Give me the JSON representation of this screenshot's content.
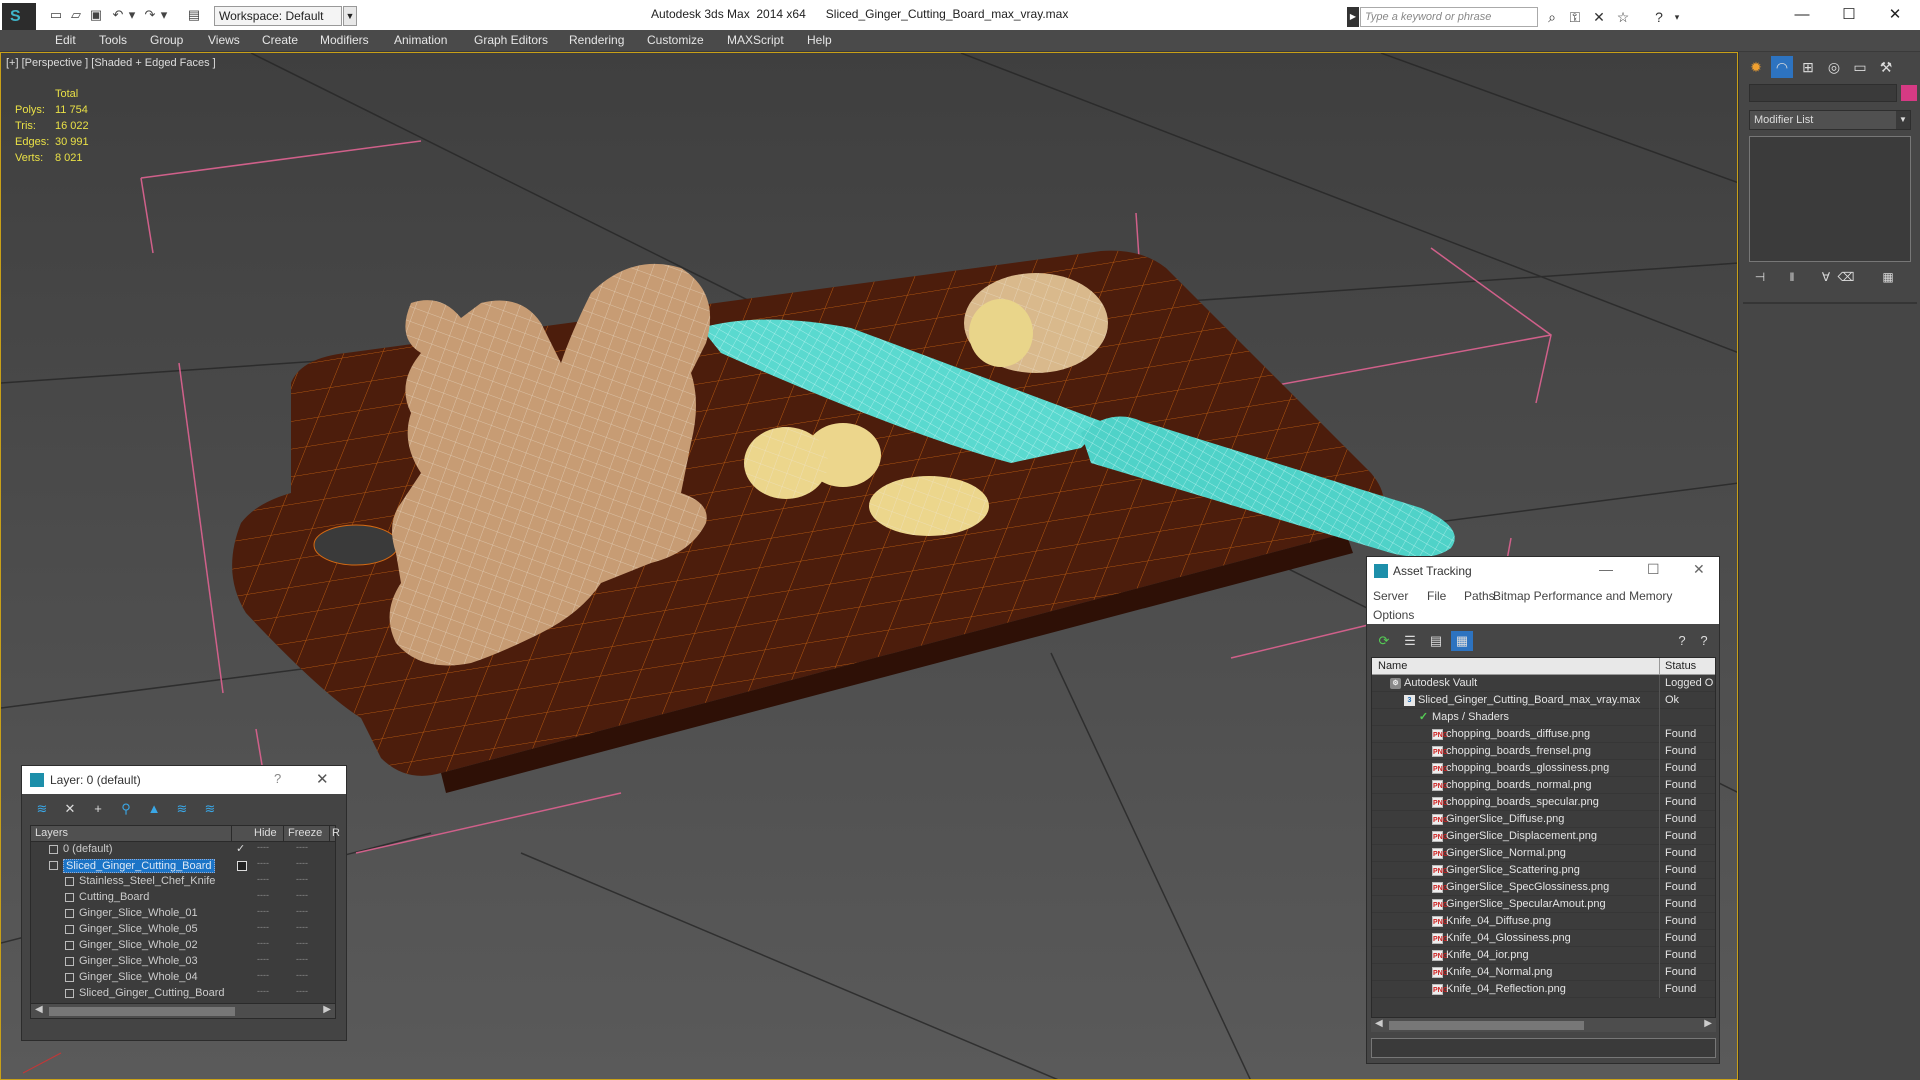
{
  "titlebar": {
    "app_title": "Autodesk 3ds Max  2014 x64      Sliced_Ginger_Cutting_Board_max_vray.max",
    "workspace_label": "Workspace: Default",
    "search_placeholder": "Type a keyword or phrase",
    "logo_glyph": "S",
    "icons": [
      "new-icon",
      "open-icon",
      "save-icon",
      "undo-icon",
      "redo-icon",
      "project-icon"
    ]
  },
  "menubar": {
    "items": [
      "Edit",
      "Tools",
      "Group",
      "Views",
      "Create",
      "Modifiers",
      "Animation",
      "Graph Editors",
      "Rendering",
      "Customize",
      "MAXScript",
      "Help"
    ]
  },
  "viewport": {
    "label": "[+] [Perspective ] [Shaded + Edged Faces ]",
    "stats": {
      "total_label": "Total",
      "rows": [
        {
          "label": "Polys:",
          "value": "11 754"
        },
        {
          "label": "Tris:",
          "value": "16 022"
        },
        {
          "label": "Edges:",
          "value": "30 991"
        },
        {
          "label": "Verts:",
          "value": "8 021"
        }
      ]
    }
  },
  "command_panel": {
    "modifier_list": "Modifier List",
    "color_swatch": "#d63a84"
  },
  "layer_dialog": {
    "title": "Layer: 0 (default)",
    "help": "?",
    "columns": {
      "layers": "Layers",
      "hide": "Hide",
      "freeze": "Freeze",
      "render": "R"
    },
    "rows": [
      {
        "name": "0 (default)",
        "indent": 0,
        "checked": true,
        "selected": false
      },
      {
        "name": "Sliced_Ginger_Cutting_Board",
        "indent": 0,
        "checked": false,
        "selected": true
      },
      {
        "name": "Stainless_Steel_Chef_Knife",
        "indent": 1,
        "checked": false,
        "selected": false
      },
      {
        "name": "Cutting_Board",
        "indent": 1,
        "checked": false,
        "selected": false
      },
      {
        "name": "Ginger_Slice_Whole_01",
        "indent": 1,
        "checked": false,
        "selected": false
      },
      {
        "name": "Ginger_Slice_Whole_05",
        "indent": 1,
        "checked": false,
        "selected": false
      },
      {
        "name": "Ginger_Slice_Whole_02",
        "indent": 1,
        "checked": false,
        "selected": false
      },
      {
        "name": "Ginger_Slice_Whole_03",
        "indent": 1,
        "checked": false,
        "selected": false
      },
      {
        "name": "Ginger_Slice_Whole_04",
        "indent": 1,
        "checked": false,
        "selected": false
      },
      {
        "name": "Sliced_Ginger_Cutting_Board",
        "indent": 1,
        "checked": false,
        "selected": false
      }
    ],
    "cell_dash": "----"
  },
  "asset_dialog": {
    "title": "Asset Tracking",
    "menus": {
      "server": "Server",
      "file": "File",
      "paths": "Paths",
      "bitmap": "Bitmap Performance and Memory",
      "options": "Options"
    },
    "columns": {
      "name": "Name",
      "status": "Status"
    },
    "rows": [
      {
        "name": "Autodesk Vault",
        "status": "Logged O",
        "indent": 0,
        "icon": "vault"
      },
      {
        "name": "Sliced_Ginger_Cutting_Board_max_vray.max",
        "status": "Ok",
        "indent": 1,
        "icon": "max"
      },
      {
        "name": "Maps / Shaders",
        "status": "",
        "indent": 2,
        "icon": "maps"
      },
      {
        "name": "chopping_boards_diffuse.png",
        "status": "Found",
        "indent": 3,
        "icon": "png"
      },
      {
        "name": "chopping_boards_frensel.png",
        "status": "Found",
        "indent": 3,
        "icon": "png"
      },
      {
        "name": "chopping_boards_glossiness.png",
        "status": "Found",
        "indent": 3,
        "icon": "png"
      },
      {
        "name": "chopping_boards_normal.png",
        "status": "Found",
        "indent": 3,
        "icon": "png"
      },
      {
        "name": "chopping_boards_specular.png",
        "status": "Found",
        "indent": 3,
        "icon": "png"
      },
      {
        "name": "GingerSlice_Diffuse.png",
        "status": "Found",
        "indent": 3,
        "icon": "png"
      },
      {
        "name": "GingerSlice_Displacement.png",
        "status": "Found",
        "indent": 3,
        "icon": "png"
      },
      {
        "name": "GingerSlice_Normal.png",
        "status": "Found",
        "indent": 3,
        "icon": "png"
      },
      {
        "name": "GingerSlice_Scattering.png",
        "status": "Found",
        "indent": 3,
        "icon": "png"
      },
      {
        "name": "GingerSlice_SpecGlossiness.png",
        "status": "Found",
        "indent": 3,
        "icon": "png"
      },
      {
        "name": "GingerSlice_SpecularAmout.png",
        "status": "Found",
        "indent": 3,
        "icon": "png"
      },
      {
        "name": "Knife_04_Diffuse.png",
        "status": "Found",
        "indent": 3,
        "icon": "png"
      },
      {
        "name": "Knife_04_Glossiness.png",
        "status": "Found",
        "indent": 3,
        "icon": "png"
      },
      {
        "name": "Knife_04_ior.png",
        "status": "Found",
        "indent": 3,
        "icon": "png"
      },
      {
        "name": "Knife_04_Normal.png",
        "status": "Found",
        "indent": 3,
        "icon": "png"
      },
      {
        "name": "Knife_04_Reflection.png",
        "status": "Found",
        "indent": 3,
        "icon": "png"
      }
    ]
  }
}
